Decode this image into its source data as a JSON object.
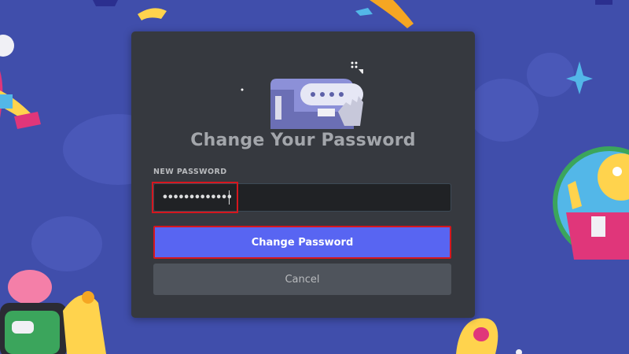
{
  "dialog": {
    "title": "Change Your Password",
    "field_label": "NEW PASSWORD",
    "password_value": "•••••••••••••",
    "primary_button_label": "Change Password",
    "secondary_button_label": "Cancel"
  },
  "icons": {
    "illustration": "locked-chest-password-icon",
    "sparkle": "sparkle-icon"
  },
  "colors": {
    "background": "#404eab",
    "modal": "#36393f",
    "input": "#202225",
    "primary": "#5865f2",
    "secondary": "#4f545c",
    "highlight": "#d6161e"
  }
}
